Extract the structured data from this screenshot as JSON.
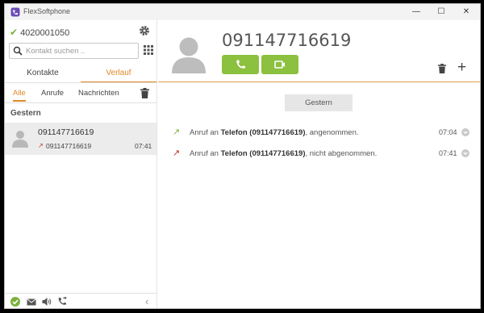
{
  "window": {
    "title": "FlexSoftphone",
    "minimize": "—",
    "maximize": "☐",
    "close": "✕"
  },
  "account": {
    "number": "4020001050"
  },
  "search": {
    "placeholder": "Kontakt suchen ..",
    "value": ""
  },
  "tabs": [
    {
      "label": "Kontakte"
    },
    {
      "label": "Verlauf",
      "active": true
    }
  ],
  "filters": [
    {
      "label": "Alle",
      "active": true
    },
    {
      "label": "Anrufe"
    },
    {
      "label": "Nachrichten"
    }
  ],
  "history": {
    "group": "Gestern",
    "items": [
      {
        "name": "091147716619",
        "number": "091147716619",
        "time": "07:41"
      }
    ]
  },
  "detail": {
    "title": "091147716619",
    "day_label": "Gestern",
    "entries": [
      {
        "prefix": "Anruf an ",
        "bold": "Telefon (091147716619)",
        "suffix": ", angenommen.",
        "time": "07:04",
        "direction": "outgoing-answered"
      },
      {
        "prefix": "Anruf an ",
        "bold": "Telefon (091147716619)",
        "suffix": ", nicht abgenommen.",
        "time": "07:41",
        "direction": "outgoing-missed"
      }
    ]
  },
  "icons": {
    "arrow_answered": "↗",
    "arrow_missed": "↗",
    "check": "✔",
    "plus": "+",
    "splitter": "⋮",
    "collapse": "‹"
  },
  "colors": {
    "accent_orange": "#e08a26",
    "call_green": "#8cc03f",
    "status_green": "#7cb13d",
    "missed_red": "#c0302b",
    "brand_purple": "#6a4bb5"
  }
}
